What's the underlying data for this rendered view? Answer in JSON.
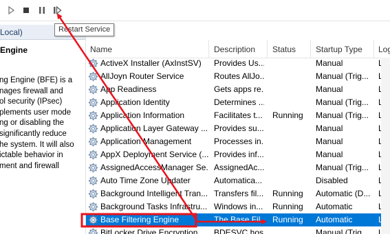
{
  "toolbar": {
    "buttons": [
      {
        "name": "start-service-button",
        "icon": "play-icon"
      },
      {
        "name": "stop-service-button",
        "icon": "stop-icon"
      },
      {
        "name": "pause-service-button",
        "icon": "pause-icon"
      },
      {
        "name": "restart-service-button",
        "icon": "restart-icon"
      }
    ],
    "tooltip": "Restart Service"
  },
  "left_pane": {
    "header": "Local)",
    "title": "Engine",
    "description_lines": [
      "ng Engine (BFE) is a",
      "nages firewall and",
      "ol security (IPsec)",
      "plements user mode",
      "ng or disabling the",
      "significantly reduce",
      "he system. It will also",
      "ictable behavior in",
      "ment and firewall"
    ]
  },
  "table": {
    "columns": [
      "Name",
      "Description",
      "Status",
      "Startup Type",
      "Log"
    ],
    "rows": [
      {
        "name": "ActiveX Installer (AxInstSV)",
        "description": "Provides Us...",
        "status": "",
        "startup": "Manual",
        "log": "Loc"
      },
      {
        "name": "AllJoyn Router Service",
        "description": "Routes AllJo...",
        "status": "",
        "startup": "Manual (Trig...",
        "log": "Loc"
      },
      {
        "name": "App Readiness",
        "description": "Gets apps re...",
        "status": "",
        "startup": "Manual",
        "log": "Loc"
      },
      {
        "name": "Application Identity",
        "description": "Determines ...",
        "status": "",
        "startup": "Manual (Trig...",
        "log": "Loc"
      },
      {
        "name": "Application Information",
        "description": "Facilitates t...",
        "status": "Running",
        "startup": "Manual (Trig...",
        "log": "Loc"
      },
      {
        "name": "Application Layer Gateway ...",
        "description": "Provides su...",
        "status": "",
        "startup": "Manual",
        "log": "Loc"
      },
      {
        "name": "Application Management",
        "description": "Processes in...",
        "status": "",
        "startup": "Manual",
        "log": "Loc"
      },
      {
        "name": "AppX Deployment Service (...",
        "description": "Provides inf...",
        "status": "",
        "startup": "Manual",
        "log": "Loc"
      },
      {
        "name": "AssignedAccessManager Se...",
        "description": "AssignedAc...",
        "status": "",
        "startup": "Manual (Trig...",
        "log": "Loc"
      },
      {
        "name": "Auto Time Zone Updater",
        "description": "Automatica...",
        "status": "",
        "startup": "Disabled",
        "log": "Loc"
      },
      {
        "name": "Background Intelligent Tran...",
        "description": "Transfers fil...",
        "status": "Running",
        "startup": "Automatic (D...",
        "log": "Loc"
      },
      {
        "name": "Background Tasks Infrastru...",
        "description": "Windows in...",
        "status": "Running",
        "startup": "Automatic",
        "log": "Loc"
      },
      {
        "name": "Base Filtering Engine",
        "description": "The Base Fil...",
        "status": "Running",
        "startup": "Automatic",
        "log": "Loc",
        "selected": true
      },
      {
        "name": "BitLocker Drive Encryption ...",
        "description": "BDESVC hos...",
        "status": "",
        "startup": "Manual (Trig...",
        "log": "Loc"
      }
    ]
  },
  "colors": {
    "selection": "#0078d7",
    "annotation": "#e8141e",
    "header_text": "#1e3a66"
  }
}
